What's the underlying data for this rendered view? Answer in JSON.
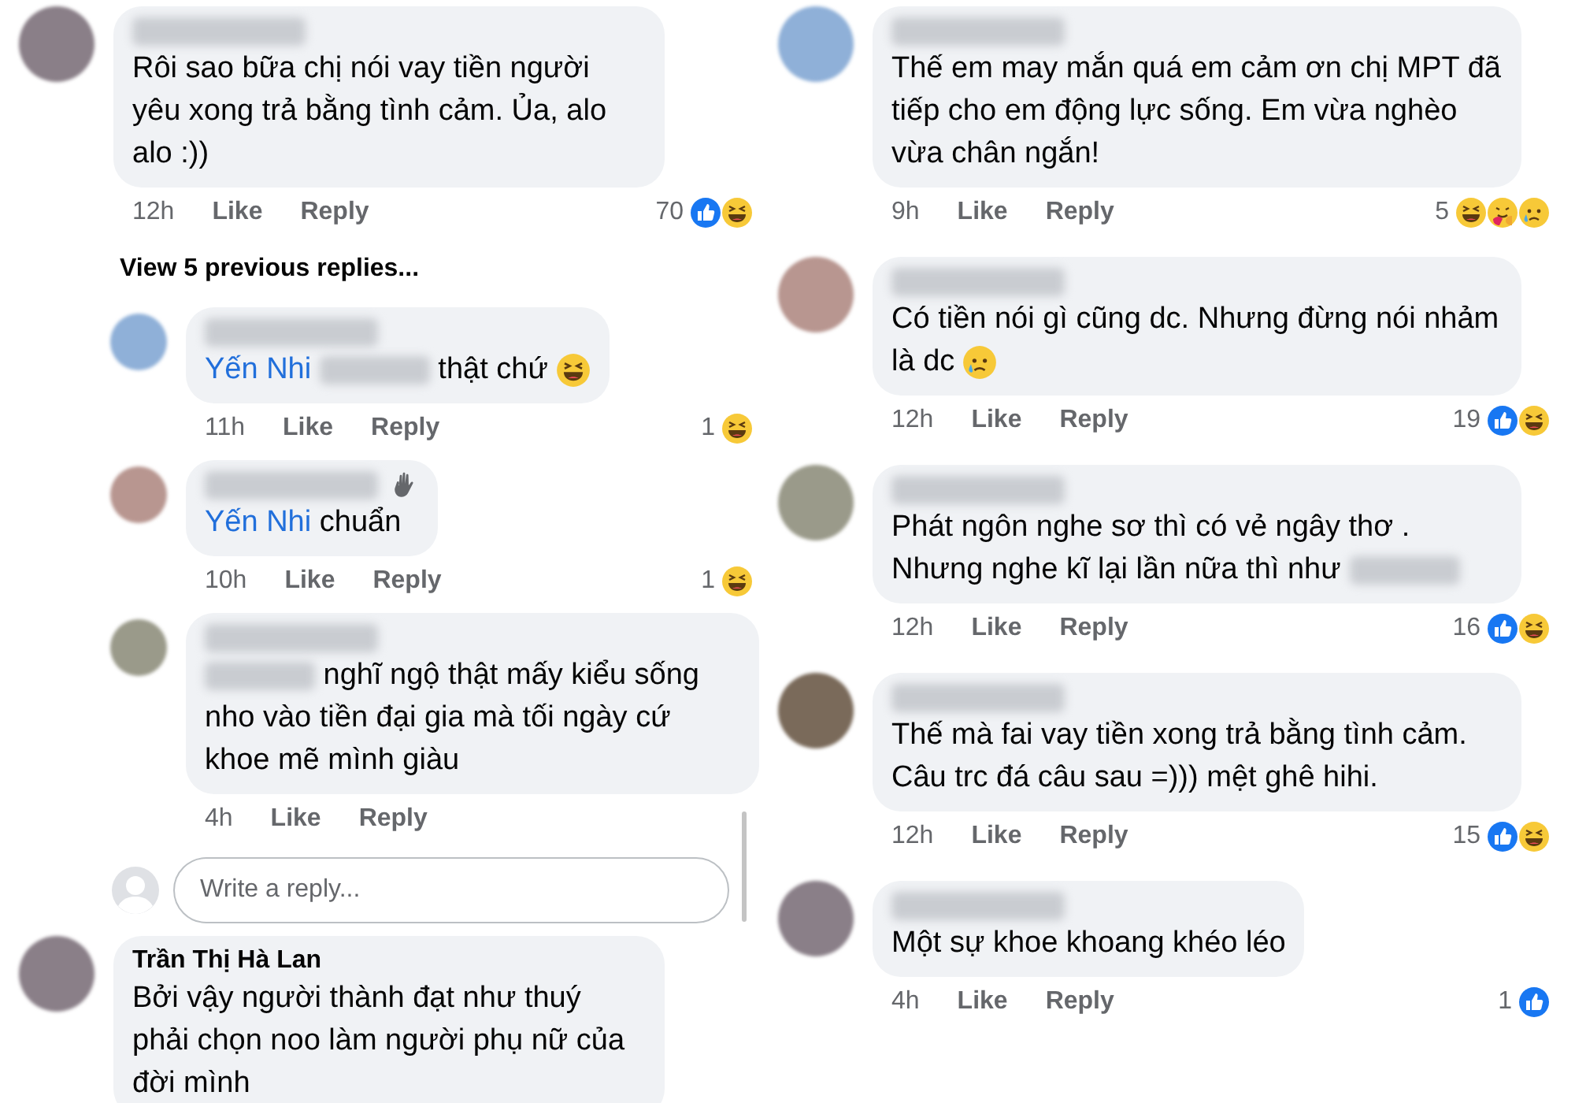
{
  "columns": [
    {
      "items": [
        {
          "kind": "comment",
          "reply": false,
          "wave_badge": false,
          "body": [
            {
              "kind": "text",
              "text": "Rôi sao bữa chị nói vay tiền người yêu xong trả bằng tình cảm. Ủa, alo alo :))"
            }
          ],
          "time": "12h",
          "like": "Like",
          "reply_label": "Reply",
          "reaction_count": "70",
          "reactions": [
            {
              "kind": "like"
            },
            {
              "kind": "haha"
            }
          ]
        },
        {
          "kind": "view_more",
          "label": "View 5 previous replies..."
        },
        {
          "kind": "comment",
          "reply": true,
          "wave_badge": false,
          "body": [
            {
              "kind": "mention",
              "text": "Yến Nhi"
            },
            {
              "kind": "blur"
            },
            {
              "kind": "text",
              "text": "thật chứ"
            },
            {
              "kind": "rofl_emoji"
            }
          ],
          "time": "11h",
          "like": "Like",
          "reply_label": "Reply",
          "reaction_count": "1",
          "reactions": [
            {
              "kind": "haha"
            }
          ]
        },
        {
          "kind": "comment",
          "reply": true,
          "wave_badge": true,
          "body": [
            {
              "kind": "mention",
              "text": "Yến Nhi"
            },
            {
              "kind": "text",
              "text": "chuẩn"
            }
          ],
          "time": "10h",
          "like": "Like",
          "reply_label": "Reply",
          "reaction_count": "1",
          "reactions": [
            {
              "kind": "haha"
            }
          ]
        },
        {
          "kind": "comment",
          "reply": true,
          "wave_badge": false,
          "body": [
            {
              "kind": "blur"
            },
            {
              "kind": "text",
              "text": "nghĩ ngộ thật mấy kiểu sống nho vào tiền đại gia mà tối ngày cứ khoe mẽ mình giàu"
            }
          ],
          "time": "4h",
          "like": "Like",
          "reply_label": "Reply"
        },
        {
          "kind": "reply_box",
          "placeholder": "Write a reply..."
        },
        {
          "kind": "comment",
          "reply": false,
          "wave_badge": false,
          "name": "Trần Thị Hà Lan",
          "body": [
            {
              "kind": "text",
              "text": "Bởi vậy người thành đạt như thuý phải chọn noo làm người phụ nữ của đời mình"
            }
          ]
        }
      ]
    },
    {
      "items": [
        {
          "kind": "comment",
          "reply": false,
          "wave_badge": false,
          "body": [
            {
              "kind": "text",
              "text": "Thế em may mắn quá em cảm ơn chị MPT đã tiếp cho em động lực sống. Em vừa nghèo vừa chân ngắn!"
            }
          ],
          "time": "9h",
          "like": "Like",
          "reply_label": "Reply",
          "reaction_count": "5",
          "reactions": [
            {
              "kind": "haha"
            },
            {
              "kind": "care"
            },
            {
              "kind": "sad"
            }
          ]
        },
        {
          "kind": "comment",
          "reply": false,
          "wave_badge": false,
          "body": [
            {
              "kind": "text",
              "text": "Có tiền nói gì cũng dc. Nhưng đừng nói nhảm là dc"
            },
            {
              "kind": "sad_emoji"
            }
          ],
          "time": "12h",
          "like": "Like",
          "reply_label": "Reply",
          "reaction_count": "19",
          "reactions": [
            {
              "kind": "like"
            },
            {
              "kind": "haha"
            }
          ]
        },
        {
          "kind": "comment",
          "reply": false,
          "wave_badge": false,
          "body": [
            {
              "kind": "text",
              "text": "Phát ngôn nghe sơ thì có vẻ ngây thơ . Nhưng nghe kĩ lại lần nữa thì như"
            },
            {
              "kind": "blur"
            }
          ],
          "time": "12h",
          "like": "Like",
          "reply_label": "Reply",
          "reaction_count": "16",
          "reactions": [
            {
              "kind": "like"
            },
            {
              "kind": "haha"
            }
          ]
        },
        {
          "kind": "comment",
          "reply": false,
          "wave_badge": false,
          "body": [
            {
              "kind": "text",
              "text": "Thế mà fai vay tiền xong trả bằng tình cảm. Câu trc đá câu sau =))) mệt ghê hihi."
            }
          ],
          "time": "12h",
          "like": "Like",
          "reply_label": "Reply",
          "reaction_count": "15",
          "reactions": [
            {
              "kind": "like"
            },
            {
              "kind": "haha"
            }
          ]
        },
        {
          "kind": "comment",
          "reply": false,
          "wave_badge": false,
          "body": [
            {
              "kind": "text",
              "text": "Một sự khoe khoang khéo léo"
            }
          ],
          "time": "4h",
          "like": "Like",
          "reply_label": "Reply",
          "reaction_count": "1",
          "reactions": [
            {
              "kind": "like"
            }
          ]
        }
      ]
    }
  ]
}
